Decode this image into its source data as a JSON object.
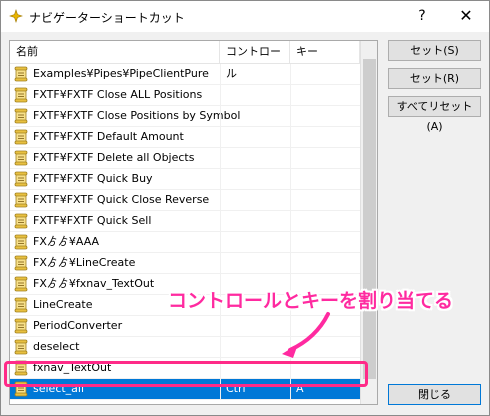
{
  "window": {
    "title": "ナビゲーターショートカット",
    "help_label": "?",
    "close_glyph": "✕"
  },
  "columns": {
    "name": "名前",
    "control": "コントロール",
    "key": "キー"
  },
  "rows": [
    {
      "name": "Examples¥Pipes¥PipeClientPure",
      "control": "",
      "key": ""
    },
    {
      "name": "FXTF¥FXTF Close ALL Positions",
      "control": "",
      "key": ""
    },
    {
      "name": "FXTF¥FXTF Close Positions by Symbol",
      "control": "",
      "key": ""
    },
    {
      "name": "FXTF¥FXTF Default Amount",
      "control": "",
      "key": ""
    },
    {
      "name": "FXTF¥FXTF Delete all Objects",
      "control": "",
      "key": ""
    },
    {
      "name": "FXTF¥FXTF Quick Buy",
      "control": "",
      "key": ""
    },
    {
      "name": "FXTF¥FXTF Quick Close Reverse",
      "control": "",
      "key": ""
    },
    {
      "name": "FXTF¥FXTF Quick Sell",
      "control": "",
      "key": ""
    },
    {
      "name": "FXゟゟ¥AAA",
      "control": "",
      "key": ""
    },
    {
      "name": "FXゟゟ¥LineCreate",
      "control": "",
      "key": ""
    },
    {
      "name": "FXゟゟ¥fxnav_TextOut",
      "control": "",
      "key": ""
    },
    {
      "name": "LineCreate",
      "control": "",
      "key": ""
    },
    {
      "name": "PeriodConverter",
      "control": "",
      "key": ""
    },
    {
      "name": "deselect",
      "control": "",
      "key": ""
    },
    {
      "name": "fxnav_TextOut",
      "control": "",
      "key": ""
    },
    {
      "name": "select_all",
      "control": "Ctrl",
      "key": "A"
    }
  ],
  "selected_index": 15,
  "buttons": {
    "set_s": "セット(S)",
    "set_r": "セット(R)",
    "reset_all": "すべてリセット(A)",
    "close": "閉じる"
  },
  "annotation": {
    "text": "コントロールとキーを割り当てる",
    "color": "#ff2aa0"
  },
  "colors": {
    "selection": "#0078d7",
    "highlight": "#ff2a88"
  },
  "icons": {
    "row_icon": "script-scroll-icon",
    "title_icon": "navigator-icon"
  }
}
